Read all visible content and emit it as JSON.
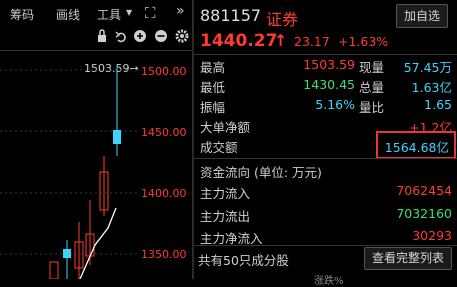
{
  "toolbar": {
    "item1": "筹码",
    "item2": "画线",
    "item3": "工具",
    "tool_arrow": "▼",
    "expand_icon": "⛶",
    "more_icon": "»"
  },
  "chart": {
    "high_marker": "1503.59→",
    "yticks": [
      "1500.00",
      "1450.00",
      "1400.00",
      "1350.00"
    ]
  },
  "quote": {
    "code": "881157",
    "name": "证券",
    "add_button": "加自选",
    "price": "1440.27",
    "arrow": "↑",
    "change": "23.17",
    "change_pct": "+1.63%"
  },
  "stats": {
    "high_label": "最高",
    "high": "1503.59",
    "vol_label": "现量",
    "vol": "57.45万",
    "low_label": "最低",
    "low": "1430.45",
    "total_label": "总量",
    "total": "1.63亿",
    "amp_label": "振幅",
    "amp": "5.16%",
    "ratio_label": "量比",
    "ratio": "1.65",
    "bignet_label": "大单净额",
    "bignet": "+1.2亿",
    "turnover_label": "成交额",
    "turnover": "1564.68亿"
  },
  "flow": {
    "title": "资金流向 (单位: 万元)",
    "in_label": "主力流入",
    "in": "7062454",
    "out_label": "主力流出",
    "out": "7032160",
    "net_label": "主力净流入",
    "net": "30293"
  },
  "footer": {
    "constituents": "共有50只成分股",
    "view_table_button": "查看完整列表",
    "col_partial": "涨跌%"
  },
  "colors": {
    "red": "#ff3b30",
    "cyan": "#3fd3ff",
    "green": "#37e07a"
  }
}
